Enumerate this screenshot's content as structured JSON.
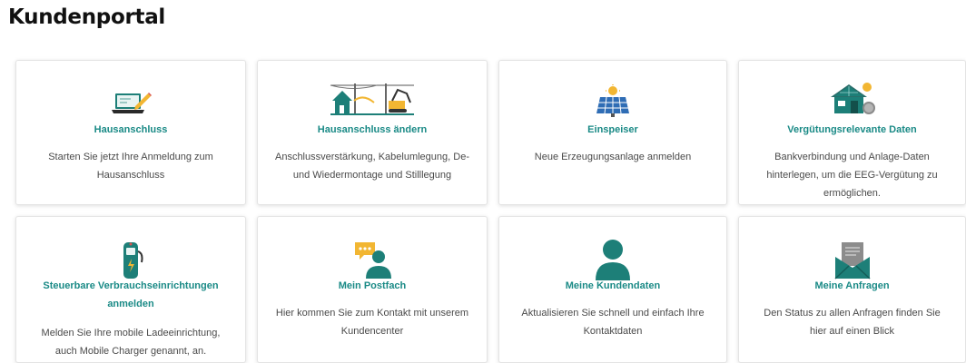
{
  "page": {
    "title": "Kundenportal"
  },
  "colors": {
    "accent": "#1a8a86",
    "icon_teal": "#1d7f78",
    "icon_yellow": "#f2b632",
    "icon_blue": "#2f6db5"
  },
  "cards": [
    {
      "icon": "laptop-pen-icon",
      "title": "Hausanschluss",
      "desc_lines": [
        "Starten Sie jetzt Ihre Anmeldung zum",
        "Hausanschluss"
      ]
    },
    {
      "icon": "house-excavator-icon",
      "title": "Hausanschluss ändern",
      "desc_lines": [
        "Anschlussverstärkung, Kabelumlegung, De-",
        "und Wiedermontage und Stilllegung"
      ]
    },
    {
      "icon": "solar-panel-icon",
      "title": "Einspeiser",
      "desc_lines": [
        "Neue Erzeugungsanlage anmelden"
      ]
    },
    {
      "icon": "solar-house-icon",
      "title": "Vergütungsrelevante Daten",
      "desc_lines": [
        "Bankverbindung und Anlage-Daten",
        "hinterlegen, um die EEG-Vergütung zu",
        "ermöglichen."
      ]
    },
    {
      "icon": "ev-charger-icon",
      "title_lines": [
        "Steuerbare Verbrauchseinrichtungen",
        "anmelden"
      ],
      "desc_lines": [
        "Melden Sie Ihre mobile Ladeeinrichtung,",
        "auch Mobile Charger genannt, an."
      ]
    },
    {
      "icon": "person-chat-icon",
      "title": "Mein Postfach",
      "desc_lines": [
        "Hier kommen Sie zum Kontakt mit unserem",
        "Kundencenter"
      ]
    },
    {
      "icon": "person-icon",
      "title": "Meine Kundendaten",
      "desc_lines": [
        "Aktualisieren Sie schnell und einfach Ihre",
        "Kontaktdaten"
      ]
    },
    {
      "icon": "envelope-letter-icon",
      "title": "Meine Anfragen",
      "desc_lines": [
        "Den Status zu allen Anfragen finden Sie",
        "hier auf einen Blick"
      ]
    }
  ]
}
